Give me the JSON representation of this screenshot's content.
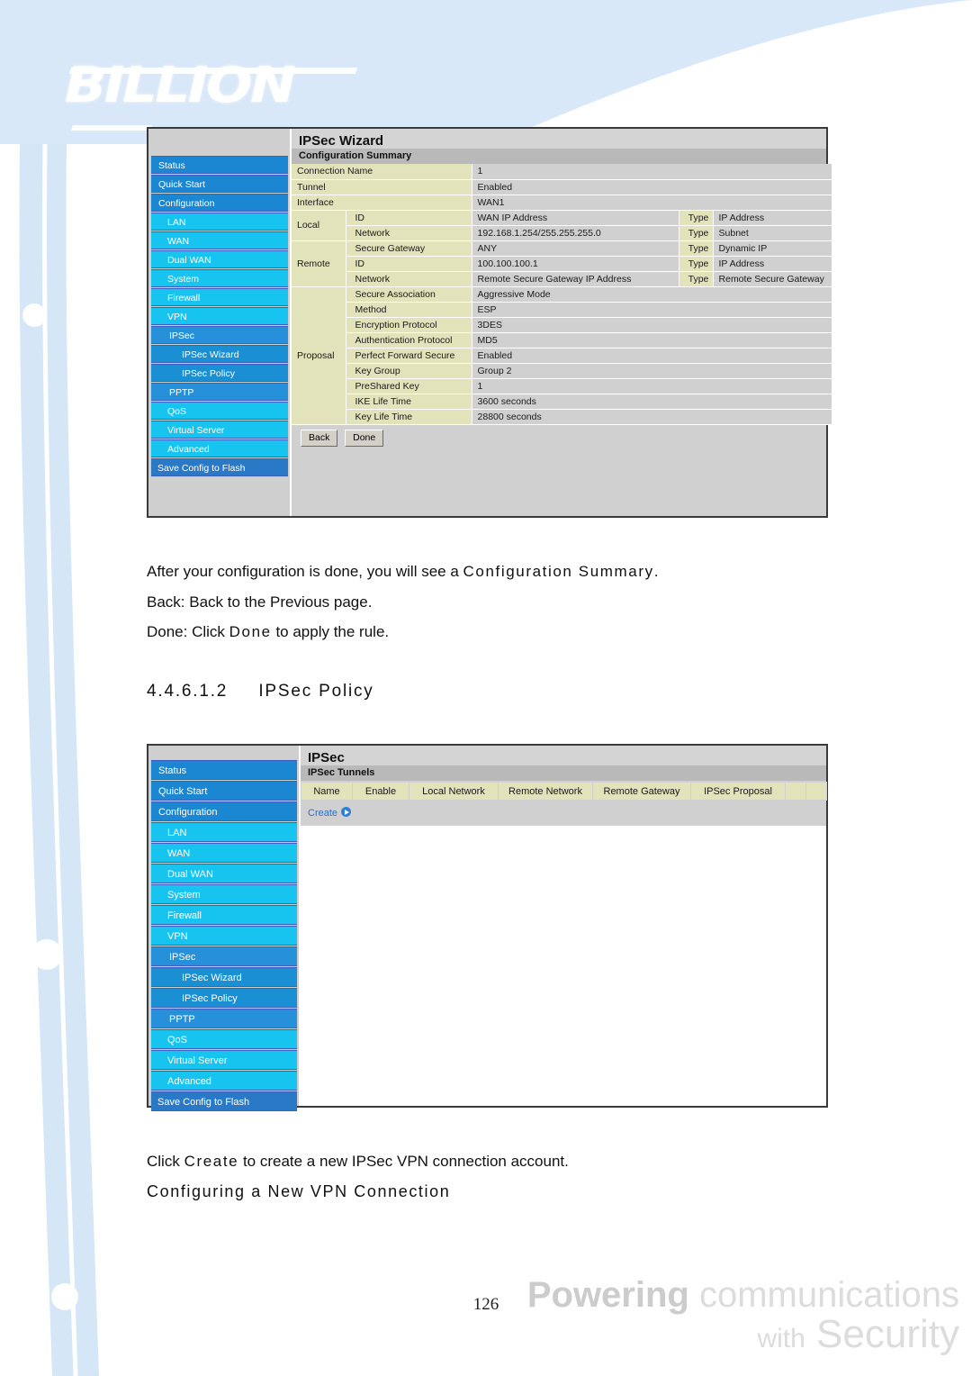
{
  "brand": {
    "logo_text": "BILLION",
    "footer_line1_bold": "Powering",
    "footer_line1_rest": "communications",
    "footer_line2_small": "with",
    "footer_line2_large": "Security"
  },
  "page": {
    "number": "126"
  },
  "colors": {
    "sidebar_top_level": "#1b86d2",
    "sidebar_sub_level": "#17c3ef",
    "table_label_bg": "#e2e2bb",
    "table_value_bg": "#d0d0d0",
    "link": "#2a6fc4",
    "page_accent": "#d5e6f7"
  },
  "sidebar": {
    "items": [
      {
        "label": "Status",
        "level": "lvl0"
      },
      {
        "label": "Quick Start",
        "level": "lvl0"
      },
      {
        "label": "Configuration",
        "level": "lvl0"
      },
      {
        "label": "LAN",
        "level": "lvl1"
      },
      {
        "label": "WAN",
        "level": "lvl1"
      },
      {
        "label": "Dual WAN",
        "level": "lvl1"
      },
      {
        "label": "System",
        "level": "lvl1"
      },
      {
        "label": "Firewall",
        "level": "lvl1"
      },
      {
        "label": "VPN",
        "level": "lvl1"
      },
      {
        "label": "IPSec",
        "level": "lvl0b"
      },
      {
        "label": "IPSec Wizard",
        "level": "lvl2"
      },
      {
        "label": "IPSec Policy",
        "level": "lvl2"
      },
      {
        "label": "PPTP",
        "level": "lvl0b"
      },
      {
        "label": "QoS",
        "level": "lvl1"
      },
      {
        "label": "Virtual Server",
        "level": "lvl1"
      },
      {
        "label": "Advanced",
        "level": "lvl1"
      },
      {
        "label": "Save Config to Flash",
        "level": "flash"
      }
    ]
  },
  "wizard_screen": {
    "title": "IPSec Wizard",
    "section_title": "Configuration Summary",
    "rows": [
      {
        "group": "",
        "label": "Connection Name",
        "value": "1",
        "type_label": "",
        "type_value": ""
      },
      {
        "group": "",
        "label": "Tunnel",
        "value": "Enabled",
        "type_label": "",
        "type_value": ""
      },
      {
        "group": "",
        "label": "Interface",
        "value": "WAN1",
        "type_label": "",
        "type_value": ""
      },
      {
        "group": "Local",
        "label": "ID",
        "value": "WAN IP Address",
        "type_label": "Type",
        "type_value": "IP Address"
      },
      {
        "group": "Local",
        "label": "Network",
        "value": "192.168.1.254/255.255.255.0",
        "type_label": "Type",
        "type_value": "Subnet"
      },
      {
        "group": "Remote",
        "label": "Secure Gateway",
        "value": "ANY",
        "type_label": "Type",
        "type_value": "Dynamic IP"
      },
      {
        "group": "Remote",
        "label": "ID",
        "value": "100.100.100.1",
        "type_label": "Type",
        "type_value": "IP Address"
      },
      {
        "group": "Remote",
        "label": "Network",
        "value": "Remote Secure Gateway IP Address",
        "type_label": "Type",
        "type_value": "Remote Secure Gateway"
      },
      {
        "group": "Proposal",
        "label": "Secure Association",
        "value": "Aggressive Mode",
        "type_label": "",
        "type_value": ""
      },
      {
        "group": "Proposal",
        "label": "Method",
        "value": "ESP",
        "type_label": "",
        "type_value": ""
      },
      {
        "group": "Proposal",
        "label": "Encryption Protocol",
        "value": "3DES",
        "type_label": "",
        "type_value": ""
      },
      {
        "group": "Proposal",
        "label": "Authentication Protocol",
        "value": "MD5",
        "type_label": "",
        "type_value": ""
      },
      {
        "group": "Proposal",
        "label": "Perfect Forward Secure",
        "value": "Enabled",
        "type_label": "",
        "type_value": ""
      },
      {
        "group": "Proposal",
        "label": "Key Group",
        "value": "Group 2",
        "type_label": "",
        "type_value": ""
      },
      {
        "group": "Proposal",
        "label": "PreShared Key",
        "value": "1",
        "type_label": "",
        "type_value": ""
      },
      {
        "group": "Proposal",
        "label": "IKE Life Time",
        "value": "3600 seconds",
        "type_label": "",
        "type_value": ""
      },
      {
        "group": "Proposal",
        "label": "Key Life Time",
        "value": "28800 seconds",
        "type_label": "",
        "type_value": ""
      }
    ],
    "group_labels": {
      "local": "Local",
      "remote": "Remote",
      "proposal": "Proposal"
    },
    "buttons": {
      "back": "Back",
      "done": "Done"
    }
  },
  "policy_screen": {
    "title": "IPSec",
    "section_title": "IPSec Tunnels",
    "columns": [
      "Name",
      "Enable",
      "Local Network",
      "Remote Network",
      "Remote Gateway",
      "IPSec Proposal",
      "",
      ""
    ],
    "create_label": "Create",
    "create_icon": "play-circle-icon",
    "rows": []
  },
  "body": {
    "para_1": "After your configuration is done, you will see a",
    "para_1_em": "Configuration Summary",
    "para_1_end": ".",
    "para_2": "Back: Back to the Previous page.",
    "para_3_a": "Done: Click",
    "para_3_em": "Done",
    "para_3_b": "to apply the rule.",
    "heading_number": "4.4.6.1.2",
    "heading_title": "IPSec Policy",
    "para_4_a": "Click",
    "para_4_em": "Create",
    "para_4_b": "to create a new IPSec VPN connection account.",
    "para_5": "Configuring a New VPN Connection"
  }
}
